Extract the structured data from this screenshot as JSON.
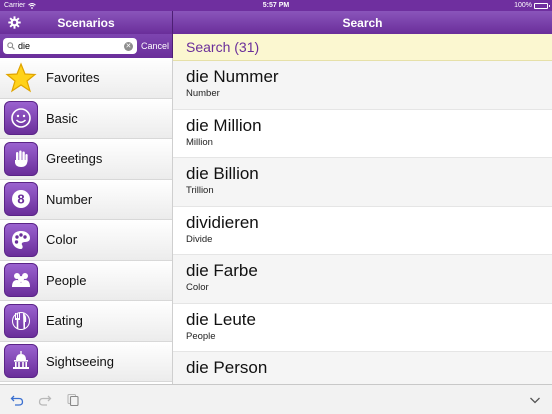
{
  "status_bar": {
    "carrier": "Carrier",
    "time": "5:57 PM",
    "battery": "100%"
  },
  "left_nav": {
    "title": "Scenarios"
  },
  "right_nav": {
    "title": "Search"
  },
  "search": {
    "value": "die",
    "cancel_label": "Cancel"
  },
  "sidebar": {
    "items": [
      {
        "label": "Favorites",
        "icon": "star-icon"
      },
      {
        "label": "Basic",
        "icon": "smiley-icon"
      },
      {
        "label": "Greetings",
        "icon": "hand-icon"
      },
      {
        "label": "Number",
        "icon": "number-icon"
      },
      {
        "label": "Color",
        "icon": "palette-icon"
      },
      {
        "label": "People",
        "icon": "people-icon"
      },
      {
        "label": "Eating",
        "icon": "cutlery-icon"
      },
      {
        "label": "Sightseeing",
        "icon": "landmark-icon"
      }
    ]
  },
  "results": {
    "header": "Search (31)",
    "items": [
      {
        "word": "die Nummer",
        "meaning": "Number"
      },
      {
        "word": "die Million",
        "meaning": "Million"
      },
      {
        "word": "die Billion",
        "meaning": "Trillion"
      },
      {
        "word": "dividieren",
        "meaning": "Divide"
      },
      {
        "word": "die Farbe",
        "meaning": "Color"
      },
      {
        "word": "die Leute",
        "meaning": "People"
      },
      {
        "word": "die Person",
        "meaning": ""
      }
    ]
  },
  "colors": {
    "accent": "#6a2e9a",
    "header_bg": "#fbf7d0"
  }
}
